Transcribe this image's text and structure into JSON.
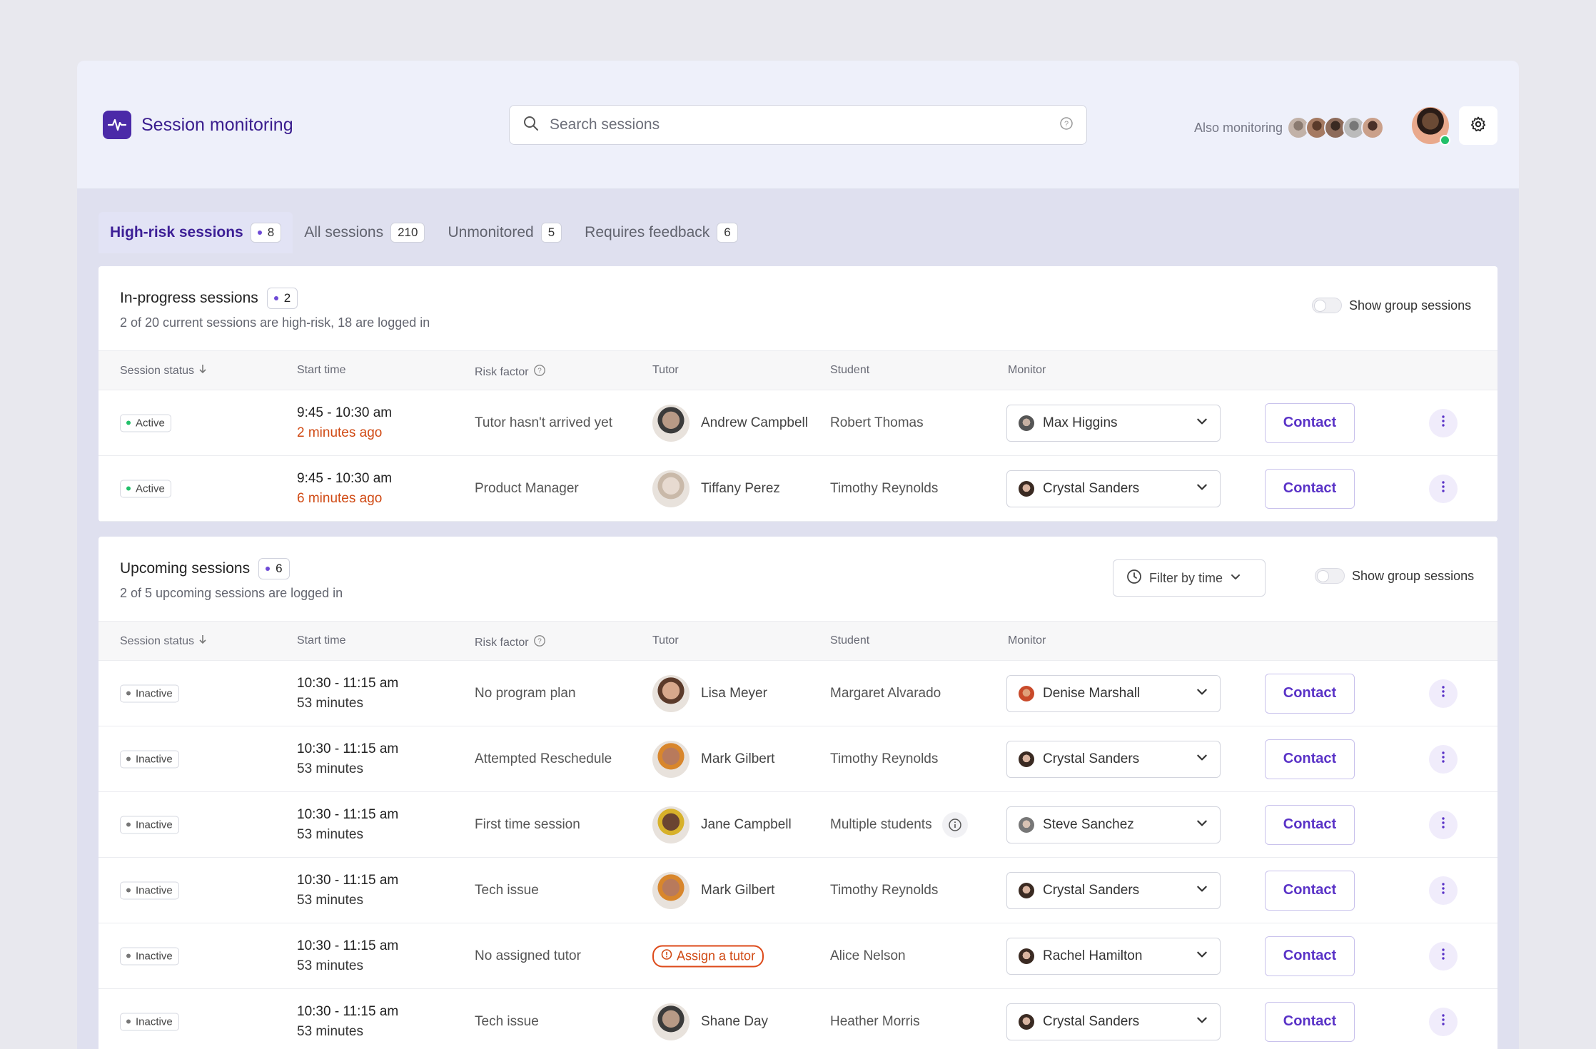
{
  "header": {
    "title": "Session monitoring",
    "search_placeholder": "Search sessions",
    "also_monitoring_label": "Also monitoring"
  },
  "tabs": [
    {
      "label": "High-risk sessions",
      "count": "8",
      "active": true
    },
    {
      "label": "All sessions",
      "count": "210"
    },
    {
      "label": "Unmonitored",
      "count": "5"
    },
    {
      "label": "Requires feedback",
      "count": "6"
    }
  ],
  "columns": {
    "status": "Session status",
    "start": "Start time",
    "risk": "Risk factor",
    "tutor": "Tutor",
    "student": "Student",
    "monitor": "Monitor"
  },
  "contact_label": "Contact",
  "in_progress": {
    "title": "In-progress sessions",
    "count": "2",
    "subtitle": "2 of 20 current sessions are high-risk, 18 are logged in",
    "toggle_label": "Show group sessions",
    "rows": [
      {
        "status": "Active",
        "time": "9:45 - 10:30 am",
        "since": "2 minutes ago",
        "risk": "Tutor hasn't arrived yet",
        "tutor": "Andrew Campbell",
        "student": "Robert Thomas",
        "monitor": "Max Higgins"
      },
      {
        "status": "Active",
        "time": "9:45 - 10:30 am",
        "since": "6 minutes ago",
        "risk": "Product Manager",
        "tutor": "Tiffany Perez",
        "student": "Timothy Reynolds",
        "monitor": "Crystal Sanders"
      }
    ]
  },
  "upcoming": {
    "title": "Upcoming sessions",
    "count": "6",
    "subtitle": "2 of 5 upcoming sessions are logged in",
    "filter_label": "Filter by time",
    "toggle_label": "Show group sessions",
    "rows": [
      {
        "status": "Inactive",
        "time": "10:30 - 11:15 am",
        "since": "53 minutes",
        "risk": "No program plan",
        "tutor": "Lisa Meyer",
        "student": "Margaret Alvarado",
        "monitor": "Denise Marshall"
      },
      {
        "status": "Inactive",
        "time": "10:30 - 11:15 am",
        "since": "53 minutes",
        "risk": "Attempted Reschedule",
        "tutor": "Mark Gilbert",
        "student": "Timothy Reynolds",
        "monitor": "Crystal Sanders"
      },
      {
        "status": "Inactive",
        "time": "10:30 - 11:15 am",
        "since": "53 minutes",
        "risk": "First time session",
        "tutor": "Jane Campbell",
        "student": "Multiple students",
        "monitor": "Steve Sanchez"
      },
      {
        "status": "Inactive",
        "time": "10:30 - 11:15 am",
        "since": "53 minutes",
        "risk": "Tech issue",
        "tutor": "Mark Gilbert",
        "student": "Timothy Reynolds",
        "monitor": "Crystal Sanders"
      },
      {
        "status": "Inactive",
        "time": "10:30 - 11:15 am",
        "since": "53 minutes",
        "risk": "No assigned tutor",
        "tutor_action": "Assign a tutor",
        "student": "Alice Nelson",
        "monitor": "Rachel Hamilton"
      },
      {
        "status": "Inactive",
        "time": "10:30 - 11:15 am",
        "since": "53 minutes",
        "risk": "Tech issue",
        "tutor": "Shane Day",
        "student": "Heather Morris",
        "monitor": "Crystal Sanders"
      }
    ]
  },
  "colors": {
    "accent": "#4b2aa8",
    "active": "#22c06a",
    "warning": "#d04a14",
    "inactive": "#777777"
  }
}
